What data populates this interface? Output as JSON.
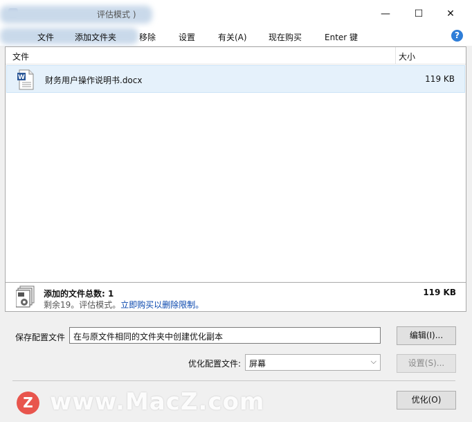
{
  "window": {
    "title": "评估模式 )",
    "controls": {
      "minimize": "—",
      "maximize": "☐",
      "close": "✕"
    }
  },
  "menu": {
    "items": [
      "文件",
      "添加文件夹",
      "移除",
      "设置",
      "有关(A)",
      "现在购买",
      "Enter 键"
    ],
    "help": "?"
  },
  "table": {
    "columns": {
      "name": "文件",
      "size": "大小"
    },
    "rows": [
      {
        "name": "财务用户操作说明书.docx",
        "size": "119 KB",
        "icon": "word-document-icon"
      }
    ]
  },
  "summary": {
    "title": "添加的文件总数: 1",
    "total_size": "119 KB",
    "status_prefix": "剩余19。评估模式。",
    "status_link": "立即购买以删除限制。"
  },
  "config": {
    "save_label": "保存配置文件",
    "save_value": "在与原文件相同的文件夹中创建优化副本",
    "edit_button": "编辑(I)...",
    "profile_label": "优化配置文件:",
    "profile_value": "屏幕",
    "settings_button": "设置(S)...",
    "optimize_button": "优化(O)"
  },
  "watermark": {
    "logo": "Z",
    "text": "www.MacZ.com"
  },
  "colors": {
    "accent": "#2f7ed8",
    "selection": "#e5f1fb",
    "link": "#0645ad"
  }
}
